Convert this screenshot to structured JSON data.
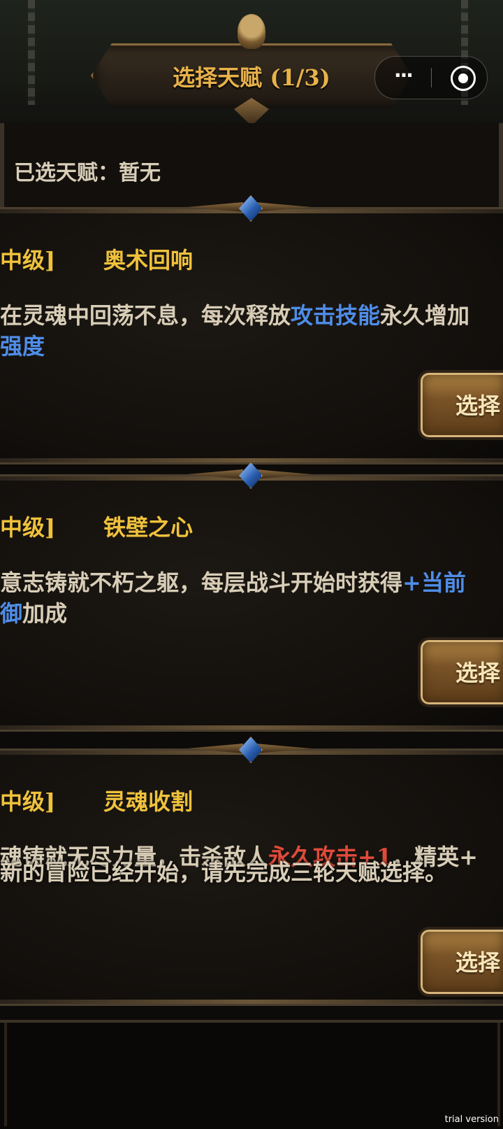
{
  "header": {
    "title": "选择天赋 (1/3)"
  },
  "capsule": {
    "more_label": "···"
  },
  "selected": {
    "label": "已选天赋：暂无"
  },
  "cards": [
    {
      "tier": "中级]",
      "name": "奥术回响",
      "desc_line1": [
        {
          "text": "在灵魂中回荡不息，每次释放",
          "style": "normal"
        },
        {
          "text": "攻击技能",
          "style": "blue"
        },
        {
          "text": "永久增加",
          "style": "normal"
        }
      ],
      "desc_line2": [
        {
          "text": "强度",
          "style": "blue"
        }
      ],
      "button_label": "选择"
    },
    {
      "tier": "中级]",
      "name": "铁壁之心",
      "desc_line1": [
        {
          "text": "意志铸就不朽之躯，每层战斗开始时获得",
          "style": "normal"
        },
        {
          "text": "+当前",
          "style": "blue"
        }
      ],
      "desc_line2": [
        {
          "text": "御",
          "style": "blue"
        },
        {
          "text": "加成",
          "style": "normal"
        }
      ],
      "button_label": "选择"
    },
    {
      "tier": "中级]",
      "name": "灵魂收割",
      "desc_line1": [
        {
          "text": "魂铸就无尽力量，击杀敌人",
          "style": "normal"
        },
        {
          "text": "永久攻击+1",
          "style": "red"
        },
        {
          "text": "，精英+",
          "style": "normal"
        }
      ],
      "button_label": "选择"
    }
  ],
  "toast": {
    "text": "新的冒险已经开始，请先完成三轮天赋选择。"
  },
  "watermark": "trial version",
  "colors": {
    "gold": "#f0c23c",
    "blue": "#4f8de8",
    "red": "#e14b3b",
    "text": "#d8cdb7"
  }
}
